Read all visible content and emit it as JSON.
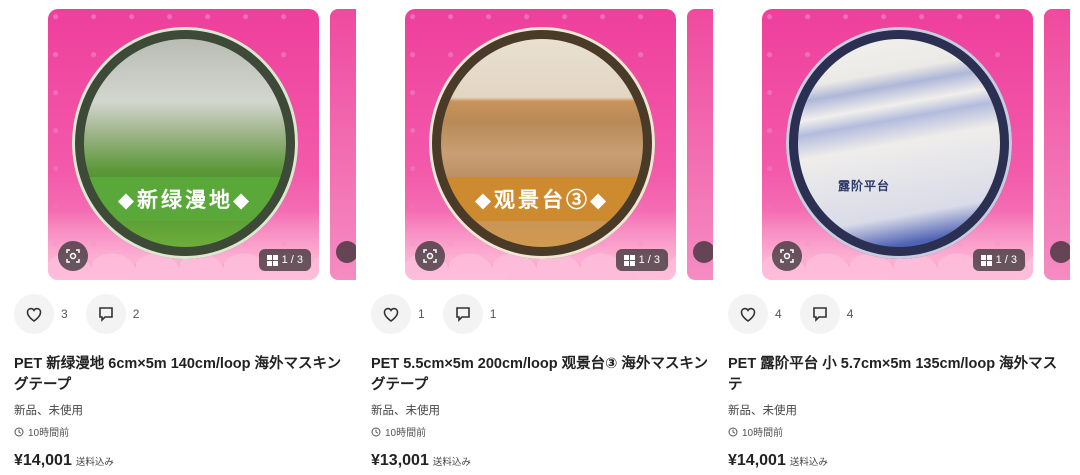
{
  "items": [
    {
      "tape_label": "◆新绿漫地◆",
      "image_counter": "1 / 3",
      "likes": "3",
      "comments": "2",
      "title": "PET 新绿漫地 6cm×5m 140cm/loop 海外マスキングテープ",
      "condition": "新品、未使用",
      "posted": "10時間前",
      "price": "¥14,001",
      "shipping": "送料込み"
    },
    {
      "tape_label": "◆观景台③◆",
      "image_counter": "1 / 3",
      "likes": "1",
      "comments": "1",
      "title": "PET 5.5cm×5m 200cm/loop 观景台③ 海外マスキングテープ",
      "condition": "新品、未使用",
      "posted": "10時間前",
      "price": "¥13,001",
      "shipping": "送料込み"
    },
    {
      "tape_label": "露阶平台",
      "image_counter": "1 / 3",
      "likes": "4",
      "comments": "4",
      "title": "PET 露阶平台 小 5.7cm×5m 135cm/loop 海外マステ",
      "condition": "新品、未使用",
      "posted": "10時間前",
      "price": "¥14,001",
      "shipping": "送料込み"
    }
  ],
  "icons": {
    "like": "heart-icon",
    "comment": "comment-icon",
    "scan": "image-search-icon",
    "gallery": "grid-icon",
    "time": "clock-icon"
  },
  "colors": {
    "product_bg": "#ee3f9c",
    "text": "#222222",
    "button_bg": "#f3f3f3"
  }
}
